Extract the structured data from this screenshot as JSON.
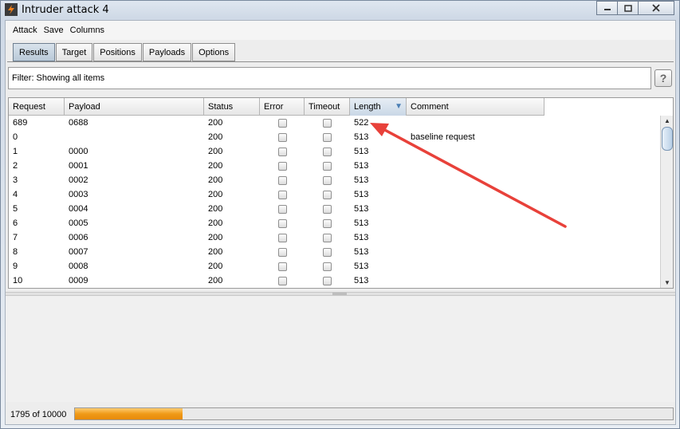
{
  "window": {
    "title": "Intruder attack 4",
    "controls": {
      "minimize": "▭",
      "maximize": "□",
      "close": "✕"
    }
  },
  "menu": [
    "Attack",
    "Save",
    "Columns"
  ],
  "tabs": [
    {
      "label": "Results",
      "active": true
    },
    {
      "label": "Target",
      "active": false
    },
    {
      "label": "Positions",
      "active": false
    },
    {
      "label": "Payloads",
      "active": false
    },
    {
      "label": "Options",
      "active": false
    }
  ],
  "filter": {
    "text": "Filter:  Showing all items",
    "help_label": "?"
  },
  "table": {
    "columns": [
      "Request",
      "Payload",
      "Status",
      "Error",
      "Timeout",
      "Length",
      "Comment"
    ],
    "sorted_column": "Length",
    "rows": [
      {
        "request": "689",
        "payload": "0688",
        "status": "200",
        "length": "522",
        "comment": ""
      },
      {
        "request": "0",
        "payload": "",
        "status": "200",
        "length": "513",
        "comment": "baseline request"
      },
      {
        "request": "1",
        "payload": "0000",
        "status": "200",
        "length": "513",
        "comment": ""
      },
      {
        "request": "2",
        "payload": "0001",
        "status": "200",
        "length": "513",
        "comment": ""
      },
      {
        "request": "3",
        "payload": "0002",
        "status": "200",
        "length": "513",
        "comment": ""
      },
      {
        "request": "4",
        "payload": "0003",
        "status": "200",
        "length": "513",
        "comment": ""
      },
      {
        "request": "5",
        "payload": "0004",
        "status": "200",
        "length": "513",
        "comment": ""
      },
      {
        "request": "6",
        "payload": "0005",
        "status": "200",
        "length": "513",
        "comment": ""
      },
      {
        "request": "7",
        "payload": "0006",
        "status": "200",
        "length": "513",
        "comment": ""
      },
      {
        "request": "8",
        "payload": "0007",
        "status": "200",
        "length": "513",
        "comment": ""
      },
      {
        "request": "9",
        "payload": "0008",
        "status": "200",
        "length": "513",
        "comment": ""
      },
      {
        "request": "10",
        "payload": "0009",
        "status": "200",
        "length": "513",
        "comment": ""
      }
    ]
  },
  "status_bar": {
    "count_text": "1795 of 10000",
    "progress_fraction": 0.1795
  },
  "colors": {
    "progress": "#f09a18",
    "annotation_arrow": "#e8413a",
    "active_tab": "#b9c9d8"
  }
}
